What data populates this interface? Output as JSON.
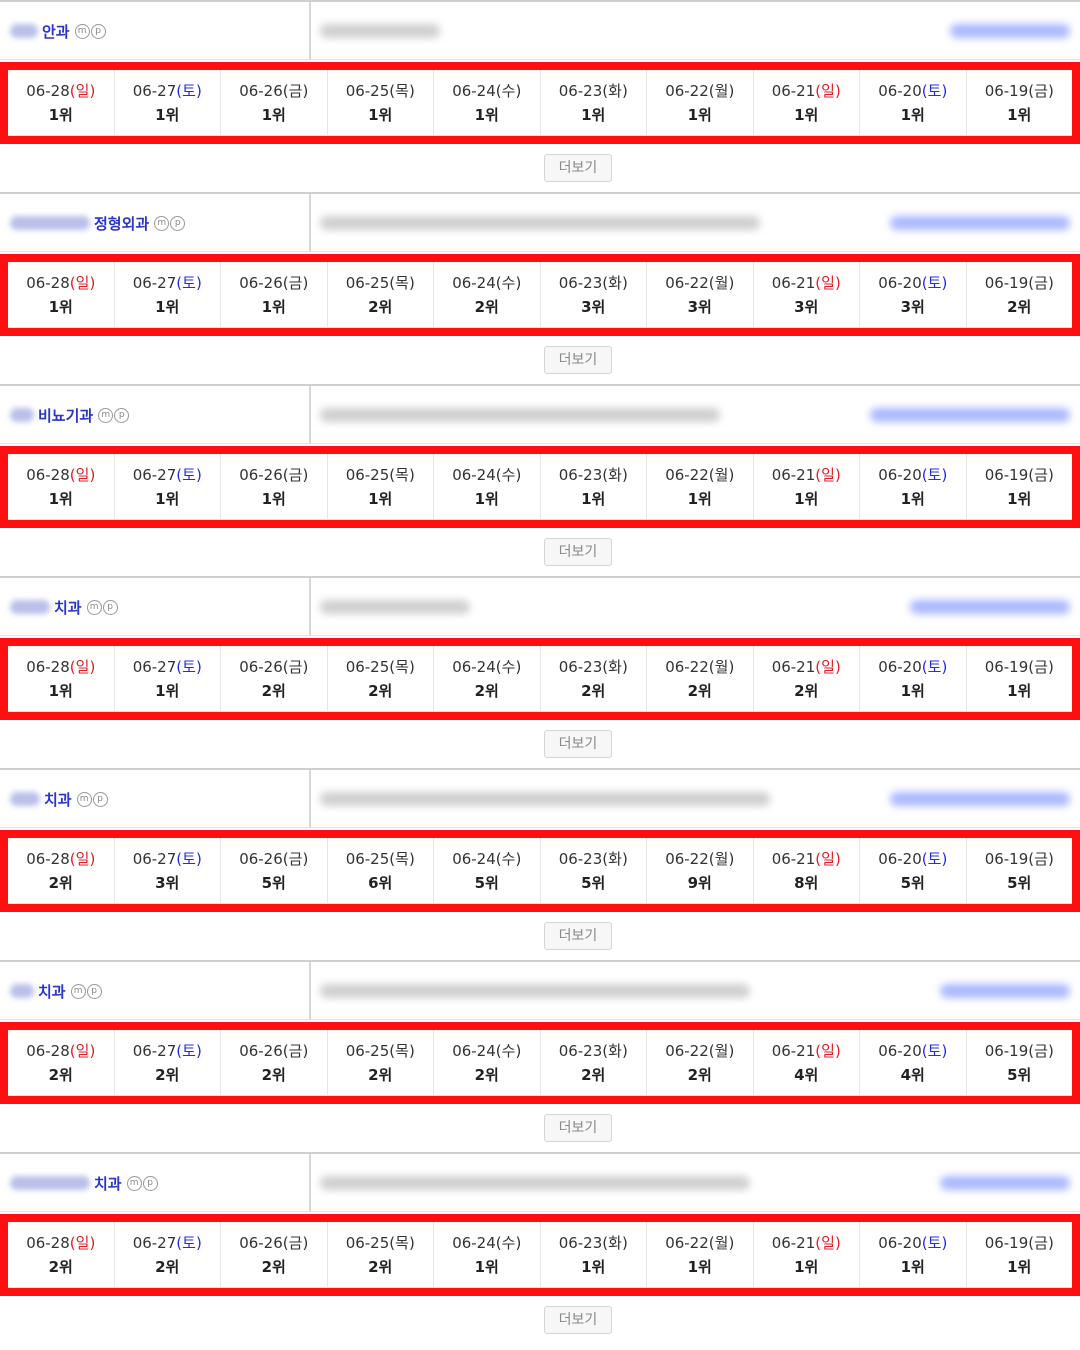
{
  "more_label": "더보기",
  "icons": {
    "mobile": "m",
    "pc": "p"
  },
  "colors": {
    "highlight_border": "#ff1010",
    "sunday": "#e02020",
    "saturday": "#2030e0",
    "name": "#2a35c9"
  },
  "sections": [
    {
      "name": "안과",
      "days": [
        {
          "date": "06-28",
          "weekday": "일",
          "rank": "1위"
        },
        {
          "date": "06-27",
          "weekday": "토",
          "rank": "1위"
        },
        {
          "date": "06-26",
          "weekday": "금",
          "rank": "1위"
        },
        {
          "date": "06-25",
          "weekday": "목",
          "rank": "1위"
        },
        {
          "date": "06-24",
          "weekday": "수",
          "rank": "1위"
        },
        {
          "date": "06-23",
          "weekday": "화",
          "rank": "1위"
        },
        {
          "date": "06-22",
          "weekday": "월",
          "rank": "1위"
        },
        {
          "date": "06-21",
          "weekday": "일",
          "rank": "1위"
        },
        {
          "date": "06-20",
          "weekday": "토",
          "rank": "1위"
        },
        {
          "date": "06-19",
          "weekday": "금",
          "rank": "1위"
        }
      ]
    },
    {
      "name": "정형외과",
      "days": [
        {
          "date": "06-28",
          "weekday": "일",
          "rank": "1위"
        },
        {
          "date": "06-27",
          "weekday": "토",
          "rank": "1위"
        },
        {
          "date": "06-26",
          "weekday": "금",
          "rank": "1위"
        },
        {
          "date": "06-25",
          "weekday": "목",
          "rank": "2위"
        },
        {
          "date": "06-24",
          "weekday": "수",
          "rank": "2위"
        },
        {
          "date": "06-23",
          "weekday": "화",
          "rank": "3위"
        },
        {
          "date": "06-22",
          "weekday": "월",
          "rank": "3위"
        },
        {
          "date": "06-21",
          "weekday": "일",
          "rank": "3위"
        },
        {
          "date": "06-20",
          "weekday": "토",
          "rank": "3위"
        },
        {
          "date": "06-19",
          "weekday": "금",
          "rank": "2위"
        }
      ]
    },
    {
      "name": "비뇨기과",
      "days": [
        {
          "date": "06-28",
          "weekday": "일",
          "rank": "1위"
        },
        {
          "date": "06-27",
          "weekday": "토",
          "rank": "1위"
        },
        {
          "date": "06-26",
          "weekday": "금",
          "rank": "1위"
        },
        {
          "date": "06-25",
          "weekday": "목",
          "rank": "1위"
        },
        {
          "date": "06-24",
          "weekday": "수",
          "rank": "1위"
        },
        {
          "date": "06-23",
          "weekday": "화",
          "rank": "1위"
        },
        {
          "date": "06-22",
          "weekday": "월",
          "rank": "1위"
        },
        {
          "date": "06-21",
          "weekday": "일",
          "rank": "1위"
        },
        {
          "date": "06-20",
          "weekday": "토",
          "rank": "1위"
        },
        {
          "date": "06-19",
          "weekday": "금",
          "rank": "1위"
        }
      ]
    },
    {
      "name": "치과",
      "days": [
        {
          "date": "06-28",
          "weekday": "일",
          "rank": "1위"
        },
        {
          "date": "06-27",
          "weekday": "토",
          "rank": "1위"
        },
        {
          "date": "06-26",
          "weekday": "금",
          "rank": "2위"
        },
        {
          "date": "06-25",
          "weekday": "목",
          "rank": "2위"
        },
        {
          "date": "06-24",
          "weekday": "수",
          "rank": "2위"
        },
        {
          "date": "06-23",
          "weekday": "화",
          "rank": "2위"
        },
        {
          "date": "06-22",
          "weekday": "월",
          "rank": "2위"
        },
        {
          "date": "06-21",
          "weekday": "일",
          "rank": "2위"
        },
        {
          "date": "06-20",
          "weekday": "토",
          "rank": "1위"
        },
        {
          "date": "06-19",
          "weekday": "금",
          "rank": "1위"
        }
      ]
    },
    {
      "name": "치과",
      "days": [
        {
          "date": "06-28",
          "weekday": "일",
          "rank": "2위"
        },
        {
          "date": "06-27",
          "weekday": "토",
          "rank": "3위"
        },
        {
          "date": "06-26",
          "weekday": "금",
          "rank": "5위"
        },
        {
          "date": "06-25",
          "weekday": "목",
          "rank": "6위"
        },
        {
          "date": "06-24",
          "weekday": "수",
          "rank": "5위"
        },
        {
          "date": "06-23",
          "weekday": "화",
          "rank": "5위"
        },
        {
          "date": "06-22",
          "weekday": "월",
          "rank": "9위"
        },
        {
          "date": "06-21",
          "weekday": "일",
          "rank": "8위"
        },
        {
          "date": "06-20",
          "weekday": "토",
          "rank": "5위"
        },
        {
          "date": "06-19",
          "weekday": "금",
          "rank": "5위"
        }
      ]
    },
    {
      "name": "치과",
      "days": [
        {
          "date": "06-28",
          "weekday": "일",
          "rank": "2위"
        },
        {
          "date": "06-27",
          "weekday": "토",
          "rank": "2위"
        },
        {
          "date": "06-26",
          "weekday": "금",
          "rank": "2위"
        },
        {
          "date": "06-25",
          "weekday": "목",
          "rank": "2위"
        },
        {
          "date": "06-24",
          "weekday": "수",
          "rank": "2위"
        },
        {
          "date": "06-23",
          "weekday": "화",
          "rank": "2위"
        },
        {
          "date": "06-22",
          "weekday": "월",
          "rank": "2위"
        },
        {
          "date": "06-21",
          "weekday": "일",
          "rank": "4위"
        },
        {
          "date": "06-20",
          "weekday": "토",
          "rank": "4위"
        },
        {
          "date": "06-19",
          "weekday": "금",
          "rank": "5위"
        }
      ]
    },
    {
      "name": "치과",
      "days": [
        {
          "date": "06-28",
          "weekday": "일",
          "rank": "2위"
        },
        {
          "date": "06-27",
          "weekday": "토",
          "rank": "2위"
        },
        {
          "date": "06-26",
          "weekday": "금",
          "rank": "2위"
        },
        {
          "date": "06-25",
          "weekday": "목",
          "rank": "2위"
        },
        {
          "date": "06-24",
          "weekday": "수",
          "rank": "1위"
        },
        {
          "date": "06-23",
          "weekday": "화",
          "rank": "1위"
        },
        {
          "date": "06-22",
          "weekday": "월",
          "rank": "1위"
        },
        {
          "date": "06-21",
          "weekday": "일",
          "rank": "1위"
        },
        {
          "date": "06-20",
          "weekday": "토",
          "rank": "1위"
        },
        {
          "date": "06-19",
          "weekday": "금",
          "rank": "1위"
        }
      ]
    }
  ]
}
